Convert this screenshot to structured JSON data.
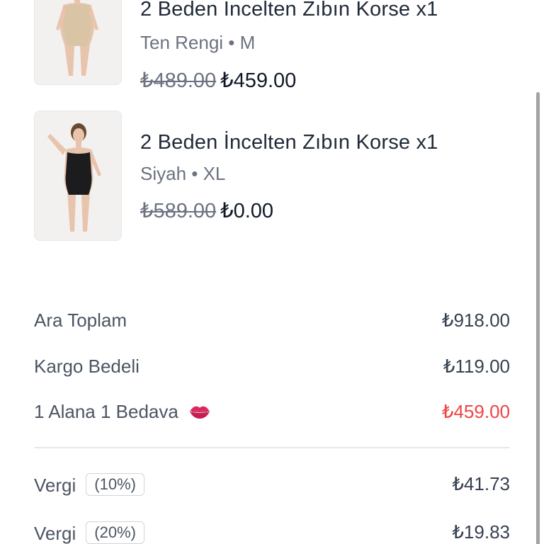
{
  "cart": {
    "items": [
      {
        "title": "2 Beden İncelten Zıbın Korse x1",
        "variant": "Ten Rengi • M",
        "old_price": "₺489.00",
        "price": "₺459.00",
        "color": "#d9c4a6"
      },
      {
        "title": "2 Beden İncelten Zıbın Korse x1",
        "variant": "Siyah • XL",
        "old_price": "₺589.00",
        "price": "₺0.00",
        "color": "#1c1c1f"
      }
    ]
  },
  "summary": {
    "subtotal_label": "Ara Toplam",
    "subtotal_value": "₺918.00",
    "shipping_label": "Kargo Bedeli",
    "shipping_value": "₺119.00",
    "discount_label": "1 Alana 1 Bedava",
    "discount_icon": "lips-icon",
    "discount_value": "₺459.00",
    "taxes": [
      {
        "label": "Vergi",
        "rate": "(10%)",
        "value": "₺41.73"
      },
      {
        "label": "Vergi",
        "rate": "(20%)",
        "value": "₺19.83"
      }
    ]
  },
  "colors": {
    "discount": "#ef4444",
    "text_primary": "#1f2937",
    "text_secondary": "#6b7280"
  }
}
